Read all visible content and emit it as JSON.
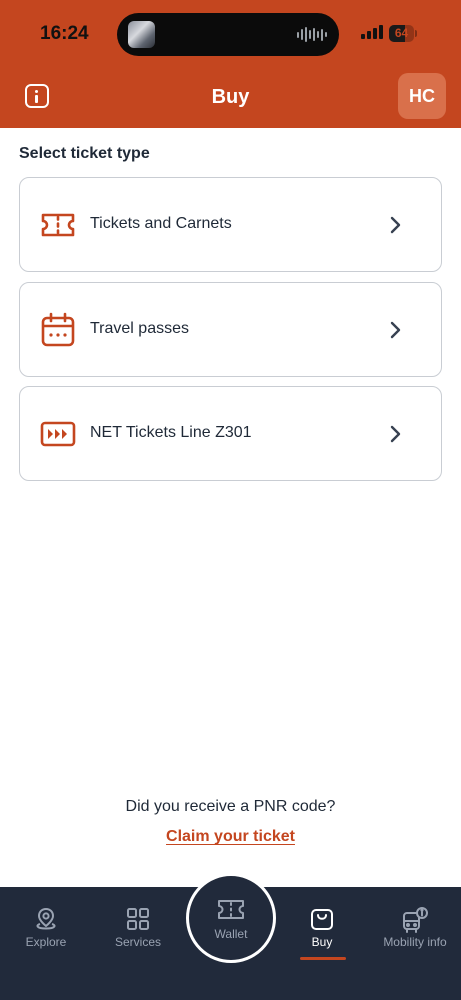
{
  "status_bar": {
    "time": "16:24",
    "battery": "64",
    "battery_level": 0.64
  },
  "header": {
    "title": "Buy",
    "avatar_initials": "HC",
    "info_icon": "info-icon"
  },
  "section_title": "Select ticket type",
  "options": [
    {
      "label": "Tickets and Carnets",
      "icon": "ticket-icon"
    },
    {
      "label": "Travel passes",
      "icon": "calendar-icon"
    },
    {
      "label": "NET Tickets Line Z301",
      "icon": "fast-forward-icon"
    }
  ],
  "pnr": {
    "question": "Did you receive a PNR code?",
    "link": "Claim your ticket"
  },
  "bottom_nav": {
    "active": "Buy",
    "items": [
      {
        "label": "Explore",
        "icon": "location-pin-icon"
      },
      {
        "label": "Services",
        "icon": "grid-icon"
      },
      {
        "label": "Wallet",
        "icon": "ticket-icon"
      },
      {
        "label": "Buy",
        "icon": "shopping-bag-icon"
      },
      {
        "label": "Mobility info",
        "icon": "bus-info-icon"
      }
    ]
  },
  "colors": {
    "accent": "#c4461f",
    "nav_background": "#212a3b",
    "text": "#1f2937"
  }
}
